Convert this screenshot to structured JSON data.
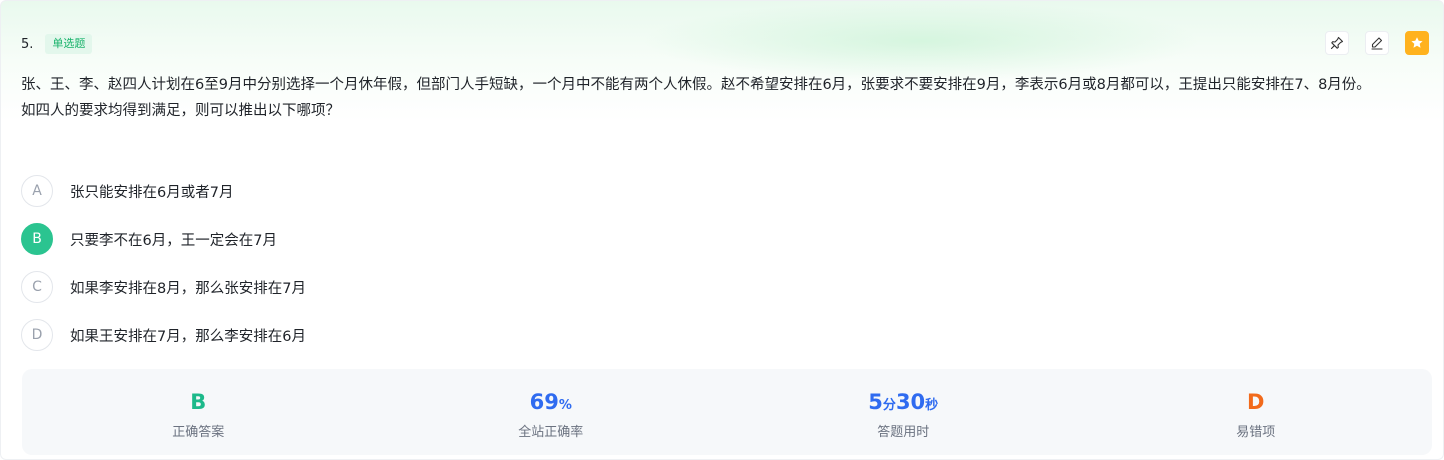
{
  "question": {
    "number": "5.",
    "type_tag": "单选题",
    "stem_line1": "张、王、李、赵四人计划在6至9月中分别选择一个月休年假，但部门人手短缺，一个月中不能有两个人休假。赵不希望安排在6月，张要求不要安排在9月，李表示6月或8月都可以，王提出只能安排在7、8月份。",
    "stem_line2": "如四人的要求均得到满足，则可以推出以下哪项？"
  },
  "tools": {
    "pin_icon": "pin-icon",
    "note_icon": "edit-icon",
    "favorite_icon": "star-icon",
    "favorite_color": "#ffb21e"
  },
  "options": [
    {
      "letter": "A",
      "text": "张只能安排在6月或者7月",
      "selected": false
    },
    {
      "letter": "B",
      "text": "只要李不在6月，王一定会在7月",
      "selected": true
    },
    {
      "letter": "C",
      "text": "如果李安排在8月，那么张安排在7月",
      "selected": false
    },
    {
      "letter": "D",
      "text": "如果王安排在7月，那么李安排在6月",
      "selected": false
    }
  ],
  "stats": {
    "correct_answer": {
      "value": "B",
      "label": "正确答案"
    },
    "site_accuracy": {
      "value": "69",
      "unit": "%",
      "label": "全站正确率"
    },
    "time_used": {
      "minutes": "5",
      "min_unit": "分",
      "seconds": "30",
      "sec_unit": "秒",
      "label": "答题用时"
    },
    "common_wrong": {
      "value": "D",
      "label": "易错项"
    }
  },
  "colors": {
    "accent_green": "#2bc490",
    "blue": "#2f6bf0",
    "orange": "#f26a1b"
  }
}
